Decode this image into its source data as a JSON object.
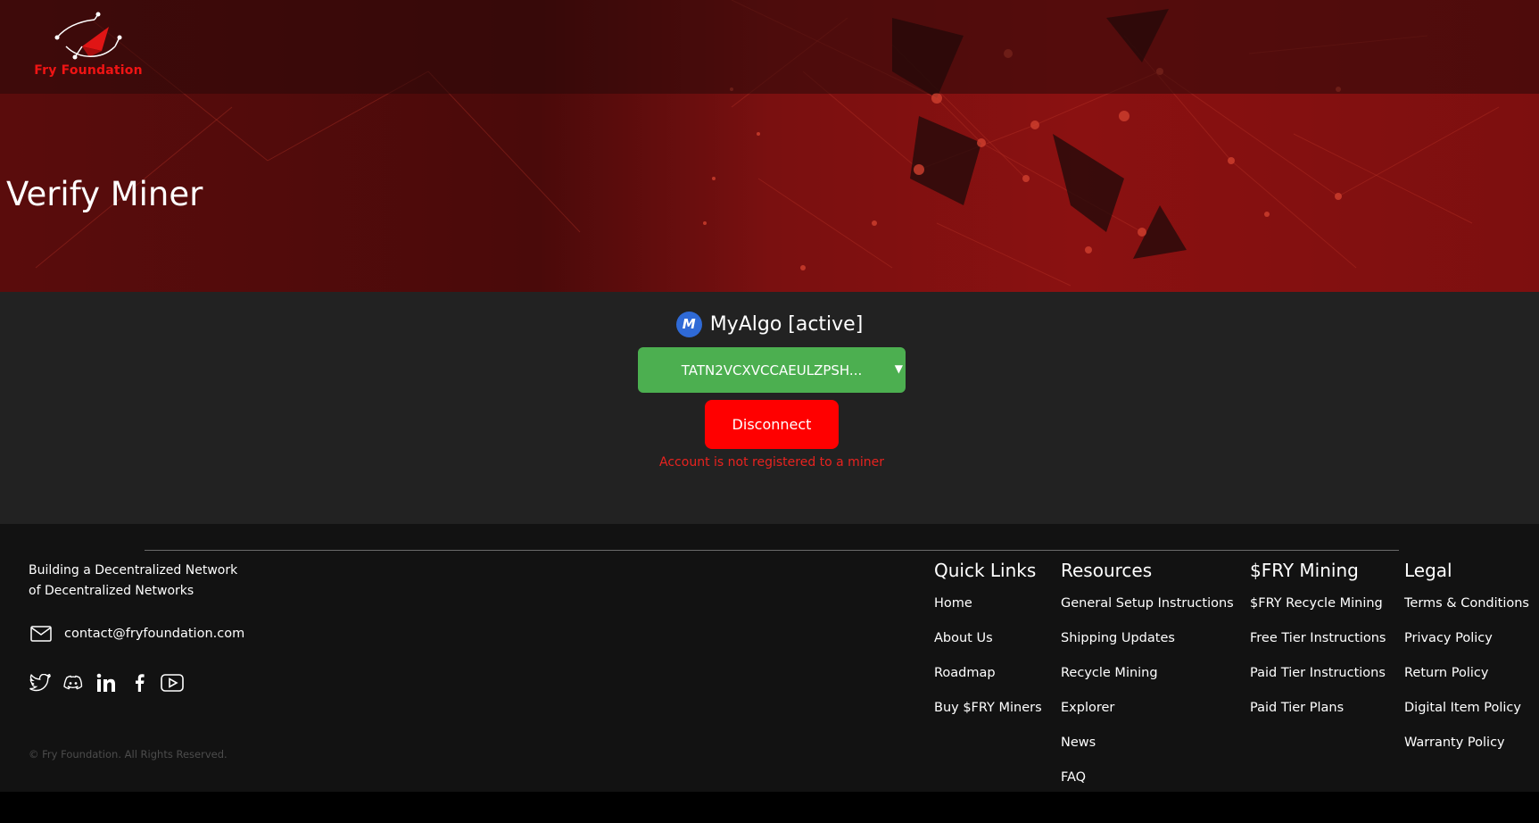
{
  "brand": {
    "name": "Fry Foundation",
    "accent": "#f01414"
  },
  "hero": {
    "title": "Verify Miner"
  },
  "wallet": {
    "provider": "MyAlgo [active]",
    "provider_icon": "myalgo-logo",
    "logo_glyph": "M",
    "selected_account": "TATN2VCXVCCAEULZPSH...",
    "disconnect_label": "Disconnect",
    "status_message": "Account is not registered to a miner"
  },
  "footer": {
    "tagline_line1": "Building a Decentralized Network",
    "tagline_line2": "of Decentralized Networks",
    "email": "contact@fryfoundation.com",
    "socials": [
      "twitter-icon",
      "discord-icon",
      "linkedin-icon",
      "facebook-icon",
      "youtube-icon"
    ],
    "copyright": "© Fry Foundation. All Rights Reserved.",
    "columns": [
      {
        "heading": "Quick Links",
        "links": [
          "Home",
          "About Us",
          "Roadmap",
          "Buy $FRY Miners"
        ]
      },
      {
        "heading": "Resources",
        "links": [
          "General Setup Instructions",
          "Shipping Updates",
          "Recycle Mining",
          "Explorer",
          "News",
          "FAQ"
        ]
      },
      {
        "heading": "$FRY Mining",
        "links": [
          "$FRY Recycle Mining",
          "Free Tier Instructions",
          "Paid Tier Instructions",
          "Paid Tier Plans"
        ]
      },
      {
        "heading": "Legal",
        "links": [
          "Terms & Conditions",
          "Privacy Policy",
          "Return Policy",
          "Digital Item Policy",
          "Warranty Policy"
        ]
      }
    ]
  },
  "colors": {
    "select_bg": "#4caf50",
    "disconnect_bg": "#ff0000",
    "error_text": "#e8221f",
    "main_bg": "#222222",
    "footer_bg": "#121212"
  }
}
